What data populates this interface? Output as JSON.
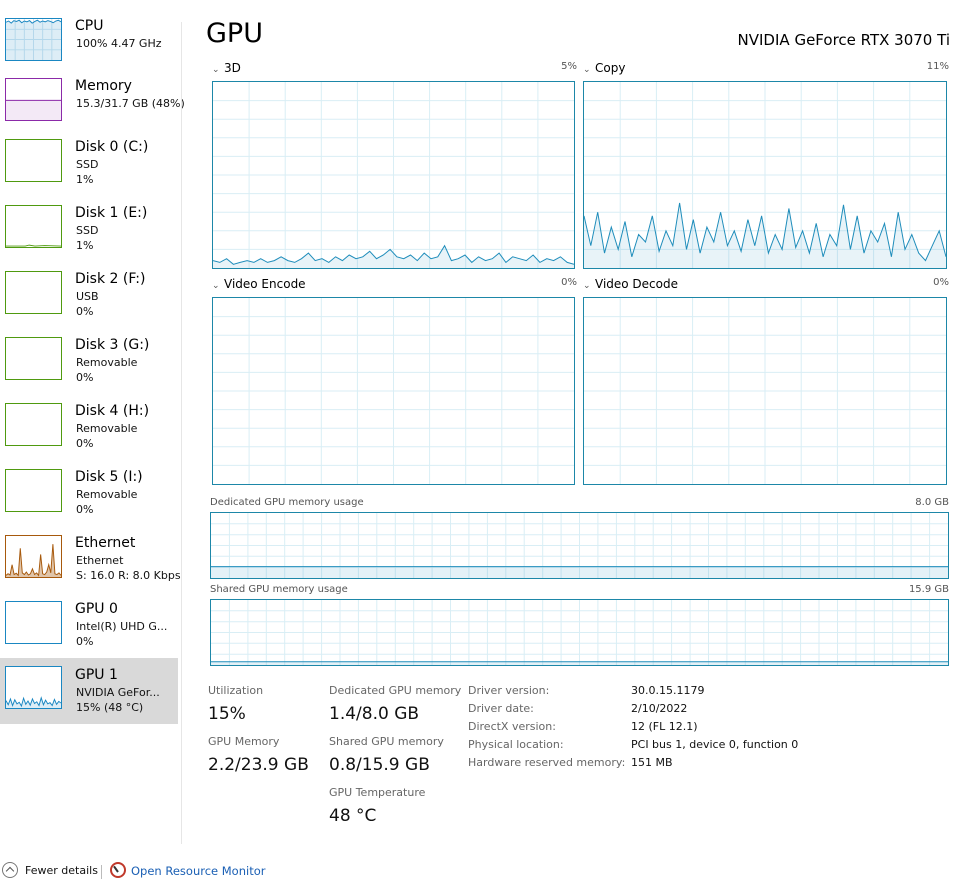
{
  "sidebar": {
    "items": [
      {
        "title": "CPU",
        "line1": "100% 4.47 GHz",
        "line2": "",
        "color": "#1a87c2",
        "selected": false
      },
      {
        "title": "Memory",
        "line1": "15.3/31.7 GB (48%)",
        "line2": "",
        "color": "#8b2aa8",
        "selected": false
      },
      {
        "title": "Disk 0 (C:)",
        "line1": "SSD",
        "line2": "1%",
        "color": "#4f9a0f",
        "selected": false
      },
      {
        "title": "Disk 1 (E:)",
        "line1": "SSD",
        "line2": "1%",
        "color": "#4f9a0f",
        "selected": false
      },
      {
        "title": "Disk 2 (F:)",
        "line1": "USB",
        "line2": "0%",
        "color": "#4f9a0f",
        "selected": false
      },
      {
        "title": "Disk 3 (G:)",
        "line1": "Removable",
        "line2": "0%",
        "color": "#4f9a0f",
        "selected": false
      },
      {
        "title": "Disk 4 (H:)",
        "line1": "Removable",
        "line2": "0%",
        "color": "#4f9a0f",
        "selected": false
      },
      {
        "title": "Disk 5 (I:)",
        "line1": "Removable",
        "line2": "0%",
        "color": "#4f9a0f",
        "selected": false
      },
      {
        "title": "Ethernet",
        "line1": "Ethernet",
        "line2": "S: 16.0  R: 8.0 Kbps",
        "color": "#a7590c",
        "selected": false
      },
      {
        "title": "GPU 0",
        "line1": "Intel(R) UHD G...",
        "line2": "0%",
        "color": "#1a87c2",
        "selected": false
      },
      {
        "title": "GPU 1",
        "line1": "NVIDIA GeFor...",
        "line2": "15%  (48 °C)",
        "color": "#1a87c2",
        "selected": true
      }
    ]
  },
  "header": {
    "title": "GPU",
    "device": "NVIDIA GeForce RTX 3070 Ti"
  },
  "engines": {
    "e3d": {
      "name": "3D",
      "percent": "5%"
    },
    "copy": {
      "name": "Copy",
      "percent": "11%"
    },
    "encode": {
      "name": "Video Encode",
      "percent": "0%"
    },
    "decode": {
      "name": "Video Decode",
      "percent": "0%"
    }
  },
  "memory_graphs": {
    "dedicated": {
      "label": "Dedicated GPU memory usage",
      "max": "8.0 GB",
      "used_fraction": 0.175
    },
    "shared": {
      "label": "Shared GPU memory usage",
      "max": "15.9 GB",
      "used_fraction": 0.05
    }
  },
  "stats": {
    "utilization": {
      "label": "Utilization",
      "value": "15%"
    },
    "dedicated_mem": {
      "label": "Dedicated GPU memory",
      "value": "1.4/8.0 GB"
    },
    "gpu_memory": {
      "label": "GPU Memory",
      "value": "2.2/23.9 GB"
    },
    "shared_mem": {
      "label": "Shared GPU memory",
      "value": "0.8/15.9 GB"
    },
    "temperature": {
      "label": "GPU Temperature",
      "value": "48 °C"
    }
  },
  "driver": [
    {
      "label": "Driver version:",
      "value": "30.0.15.1179"
    },
    {
      "label": "Driver date:",
      "value": "2/10/2022"
    },
    {
      "label": "DirectX version:",
      "value": "12 (FL 12.1)"
    },
    {
      "label": "Physical location:",
      "value": "PCI bus 1, device 0, function 0"
    },
    {
      "label": "Hardware reserved memory:",
      "value": "151 MB"
    }
  ],
  "footer": {
    "fewer_details": "Fewer details",
    "open_resource_monitor": "Open Resource Monitor"
  },
  "series": {
    "e3d": [
      4,
      3,
      5,
      2,
      3,
      4,
      3,
      5,
      3,
      4,
      6,
      4,
      3,
      5,
      8,
      4,
      5,
      3,
      6,
      4,
      7,
      5,
      6,
      9,
      5,
      7,
      10,
      6,
      5,
      7,
      4,
      8,
      5,
      6,
      12,
      4,
      5,
      7,
      3,
      6,
      4,
      5,
      8,
      3,
      6,
      5,
      4,
      7,
      3,
      5,
      4,
      6,
      3,
      2
    ],
    "copy": [
      28,
      12,
      30,
      8,
      22,
      10,
      25,
      6,
      18,
      14,
      28,
      9,
      20,
      12,
      35,
      10,
      26,
      8,
      22,
      14,
      30,
      12,
      20,
      9,
      26,
      12,
      28,
      8,
      18,
      10,
      32,
      11,
      20,
      8,
      24,
      6,
      18,
      12,
      34,
      10,
      28,
      8,
      20,
      14,
      24,
      6,
      30,
      10,
      18,
      8,
      4,
      12,
      20,
      6
    ],
    "cpu": [
      92,
      95,
      90,
      96,
      94,
      97,
      91,
      95,
      93,
      96,
      90,
      94,
      97,
      92,
      95,
      93,
      96,
      94,
      91,
      95,
      97,
      93
    ],
    "ethernet": [
      4,
      8,
      5,
      30,
      6,
      9,
      4,
      70,
      10,
      6,
      12,
      5,
      8,
      20,
      6,
      10,
      4,
      55,
      8,
      6,
      12,
      30,
      10,
      80,
      8,
      6,
      10,
      4
    ],
    "gpu1": [
      18,
      8,
      22,
      6,
      20,
      10,
      14,
      5,
      24,
      9,
      17,
      7,
      22,
      11,
      15,
      6,
      25,
      8,
      19,
      10,
      13,
      6,
      21,
      9,
      16,
      12
    ]
  }
}
